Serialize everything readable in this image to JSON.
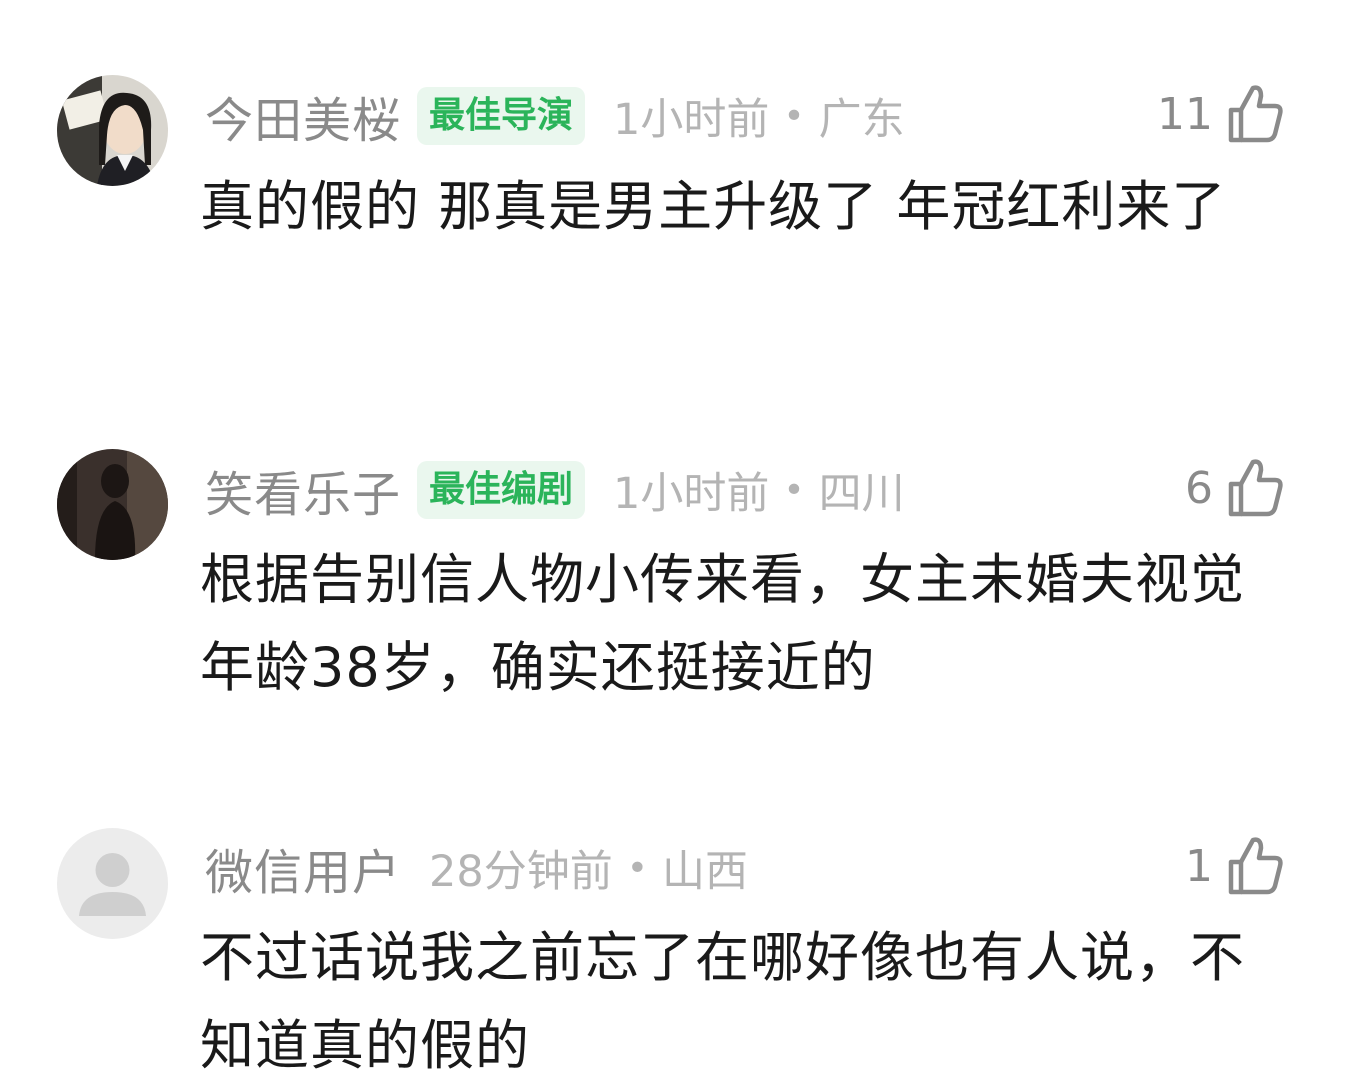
{
  "comments": [
    {
      "username": "今田美桜",
      "badge": "最佳导演",
      "time": "1小时前",
      "separator": "•",
      "location": "广东",
      "likes": "11",
      "text": "真的假的 那真是男主升级了 年冠红利来了",
      "avatar": "photo-avatar-girl"
    },
    {
      "username": "笑看乐子",
      "badge": "最佳编剧",
      "time": "1小时前",
      "separator": "•",
      "location": "四川",
      "likes": "6",
      "text": "根据告别信人物小传来看，女主未婚夫视觉年龄38岁，确实还挺接近的",
      "avatar": "photo-avatar-silhouette"
    },
    {
      "username": "微信用户",
      "badge": "",
      "time": "28分钟前",
      "separator": "•",
      "location": "山西",
      "likes": "1",
      "text": "不过话说我之前忘了在哪好像也有人说，不知道真的假的",
      "avatar": "default-user-icon"
    }
  ],
  "colors": {
    "badge_text": "#2bb45a",
    "badge_bg": "#eaf7ee",
    "username": "#8a8a8a",
    "meta": "#b4b4b4",
    "content": "#1a1a1a"
  }
}
